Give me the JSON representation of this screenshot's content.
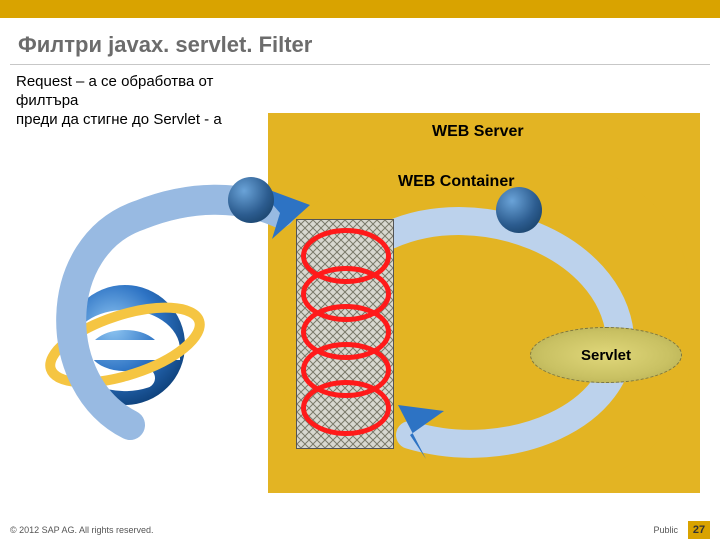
{
  "slide": {
    "title": "Филтри javax. servlet. Filter",
    "request_text": "Request – а се обработва от филтъра\n преди да стигне до Servlet - а",
    "web_server_label": "WEB Server",
    "web_container_label": "WEB Container",
    "servlet_label": "Servlet"
  },
  "footer": {
    "copyright": "© 2012 SAP AG. All rights reserved.",
    "classification": "Public",
    "page": "27"
  },
  "icons": {
    "browser": "internet-explorer-icon",
    "filter_ring": "filter-ring-icon",
    "arrow": "curved-arrow-icon"
  },
  "colors": {
    "accent": "#d9a300",
    "ring": "#ff1a1a",
    "arrow_blue": "#2d73c4",
    "arrow_fill": "#bcd2ec"
  }
}
